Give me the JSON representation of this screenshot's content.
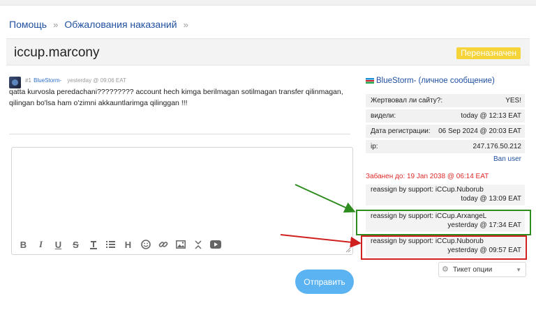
{
  "breadcrumb": {
    "items": [
      "Помощь",
      "Обжалования наказаний"
    ],
    "separator": "»"
  },
  "header": {
    "title": "iccup.marcony",
    "status_badge": "Переназначен"
  },
  "post": {
    "number": "#1",
    "author": "BlueStorm-",
    "time": "yesterday @ 09:06 EAT",
    "text": "qatta kurvosla peredachani????????? account hech kimga berilmagan sotilmagan transfer qilinmagan, qilingan bo'lsa ham o'zimni akkauntlarimga qilinggan !!!"
  },
  "composer": {
    "toolbar_icons": [
      "bold-icon",
      "italic-icon",
      "underline-icon",
      "strikethrough-icon",
      "text-color-icon",
      "list-icon",
      "heading-icon",
      "smile-icon",
      "link-icon",
      "image-icon",
      "collapse-icon",
      "video-icon"
    ],
    "send_label": "Отправить"
  },
  "sidebar": {
    "username": "BlueStorm-",
    "pm_label": "(личное сообщение)",
    "info": [
      {
        "label": "Жертвовал ли сайту?:",
        "value": "YES!"
      },
      {
        "label": "видели:",
        "value": "today @ 12:13 EAT"
      },
      {
        "label": "Дата регистрации:",
        "value": "06 Sep 2024 @ 20:03 EAT"
      },
      {
        "label": "ip:",
        "value": "247.176.50.212"
      }
    ],
    "ban_link": "Ban user",
    "banned_until": "Забанен до: 19 Jan 2038 @ 06:14 EAT",
    "log": [
      {
        "text": "reassign by support: iCCup.Nuborub",
        "time": "today @ 13:09 EAT"
      },
      {
        "text": "reassign by support: iCCup.ArxangeL",
        "time": "yesterday @ 17:34 EAT"
      },
      {
        "text": "reassign by support: iCCup.Nuborub",
        "time": "yesterday @ 09:57 EAT"
      }
    ],
    "ticket_options": "Тикет опции"
  },
  "colors": {
    "link": "#1f4fa0",
    "badge": "#f5d43a",
    "send_button": "#5bb3f2",
    "banned": "#e02a2a",
    "highlight_green": "#2e8b1d",
    "highlight_red": "#d01f1f"
  }
}
